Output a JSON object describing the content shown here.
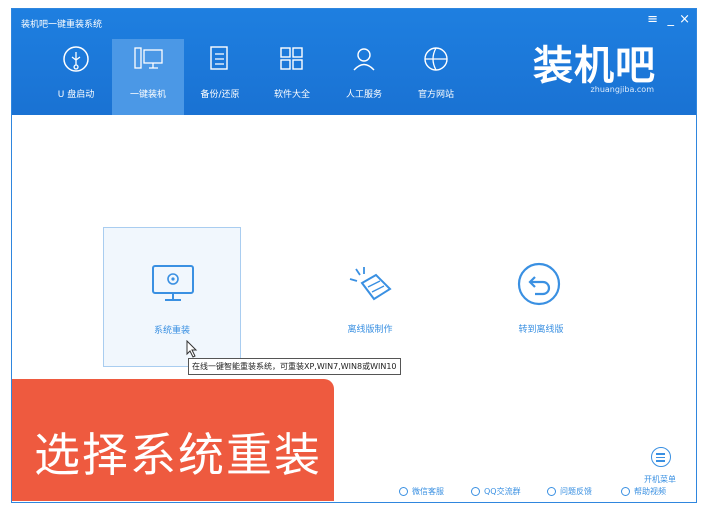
{
  "window": {
    "title": "装机吧一键重装系统",
    "controls": {
      "menu": "≡",
      "minimize": "_",
      "close": "×"
    }
  },
  "nav": [
    {
      "label": "U 盘启动",
      "icon": "usb-icon"
    },
    {
      "label": "一键装机",
      "icon": "computer-icon",
      "active": true
    },
    {
      "label": "备份/还原",
      "icon": "backup-icon"
    },
    {
      "label": "软件大全",
      "icon": "apps-grid-icon"
    },
    {
      "label": "人工服务",
      "icon": "user-service-icon"
    },
    {
      "label": "官方网站",
      "icon": "globe-icon"
    }
  ],
  "logo": {
    "text": "装机吧",
    "sub": "zhuangjiba.com"
  },
  "cards": [
    {
      "label": "系统重装",
      "icon": "monitor-gear-icon",
      "selected": true
    },
    {
      "label": "离线版制作",
      "icon": "offline-package-icon"
    },
    {
      "label": "转到离线版",
      "icon": "switch-back-icon"
    }
  ],
  "tooltip": "在线一键智能重装系统，可重装XP,WIN7,WIN8或WIN10",
  "overlay_caption": "选择系统重装",
  "side_menu_label": "开机菜单",
  "footer": [
    {
      "label": "微信客服",
      "icon": "wechat-icon"
    },
    {
      "label": "QQ交流群",
      "icon": "qq-icon"
    },
    {
      "label": "问题反馈",
      "icon": "feedback-icon"
    },
    {
      "label": "帮助视频",
      "icon": "help-icon"
    }
  ],
  "colors": {
    "header": "#1e7fe0",
    "accent": "#3a90e2",
    "overlay": "#ee5a3f"
  }
}
